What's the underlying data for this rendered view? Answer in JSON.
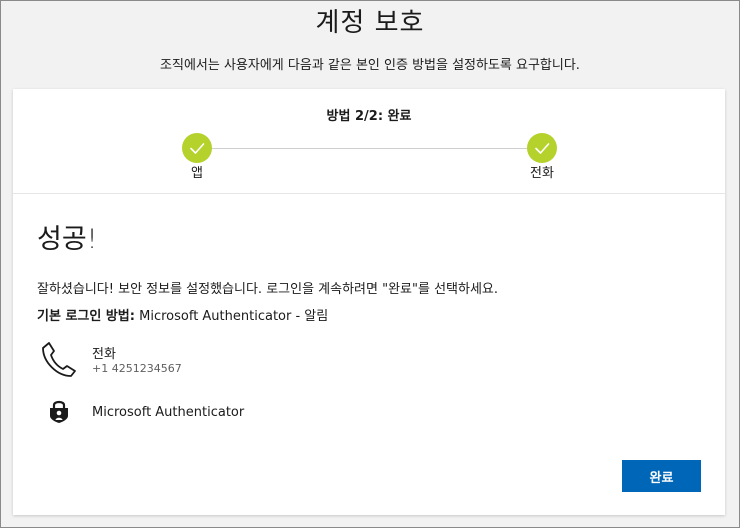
{
  "page": {
    "title": "계정 보호",
    "subtitle": "조직에서는 사용자에게 다음과 같은 본인 인증 방법을 설정하도록 요구합니다."
  },
  "stepper": {
    "title": "방법 2/2: 완료",
    "steps": [
      {
        "label": "앱",
        "status": "complete"
      },
      {
        "label": "전화",
        "status": "complete"
      }
    ],
    "complete_color": "#b4d22b"
  },
  "result": {
    "heading": "성공!",
    "message": "잘하셨습니다! 보안 정보를 설정했습니다. 로그인을 계속하려면 \"완료\"를 선택하세요.",
    "default_method_label": "기본 로그인 방법:",
    "default_method_value": "Microsoft Authenticator - 알림"
  },
  "methods": [
    {
      "icon": "phone-icon",
      "name": "전화",
      "detail": "+1 4251234567"
    },
    {
      "icon": "authenticator-lock-icon",
      "name": "Microsoft Authenticator"
    }
  ],
  "actions": {
    "done_label": "완료",
    "accent_color": "#0067b8"
  }
}
